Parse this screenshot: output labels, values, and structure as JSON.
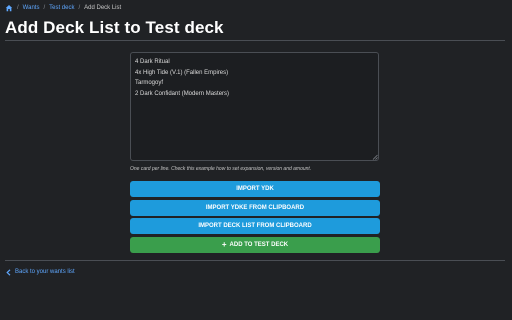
{
  "breadcrumb": {
    "home_icon": "home-icon",
    "items": [
      "Wants",
      "Test deck"
    ],
    "current": "Add Deck List"
  },
  "page": {
    "title": "Add Deck List to Test deck"
  },
  "deck_input": {
    "value": "4 Dark Ritual\n4x High Tide (V.1) (Fallen Empires)\nTarmogoyf\n2 Dark Confidant (Modern Masters)",
    "help": "One card per line. Check this example how to set expansion, version and amount."
  },
  "buttons": {
    "import_ydk": "IMPORT YDK",
    "import_ydk_clipboard": "IMPORT YDKE FROM CLIPBOARD",
    "import_deck_clipboard": "IMPORT DECK LIST FROM CLIPBOARD",
    "add": "ADD TO TEST DECK",
    "add_icon": "plus-icon"
  },
  "back": {
    "label": "Back to your wants list",
    "icon": "chevron-left-icon"
  },
  "colors": {
    "background": "#202225",
    "link": "#5fa8ff",
    "primary": "#1e9bdc",
    "success": "#3a9e4c"
  }
}
